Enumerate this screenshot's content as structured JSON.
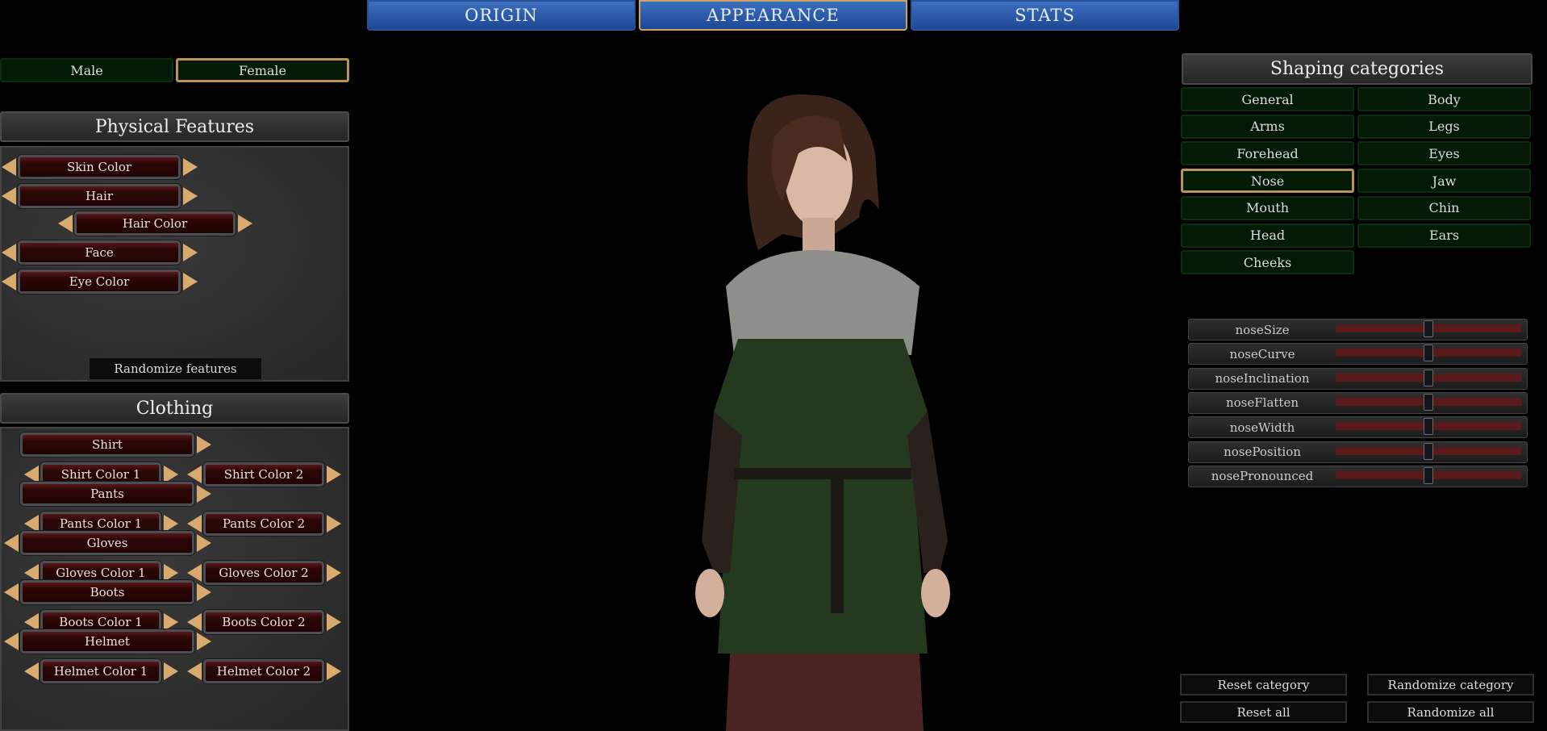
{
  "tabs": [
    {
      "label": "ORIGIN",
      "selected": false
    },
    {
      "label": "APPEARANCE",
      "selected": true
    },
    {
      "label": "STATS",
      "selected": false
    }
  ],
  "gender": {
    "options": [
      "Male",
      "Female"
    ],
    "selected": "Female"
  },
  "physical": {
    "title": "Physical Features",
    "items": [
      {
        "label": "Skin Color",
        "indent": false
      },
      {
        "label": "Hair",
        "indent": false
      },
      {
        "label": "Hair Color",
        "indent": true
      },
      {
        "label": "Face",
        "indent": false
      },
      {
        "label": "Eye Color",
        "indent": false
      }
    ],
    "randomize": "Randomize features"
  },
  "clothing": {
    "title": "Clothing",
    "groups": [
      {
        "label": "Shirt",
        "left_arrow": false,
        "colors": [
          "Shirt Color 1",
          "Shirt Color 2"
        ]
      },
      {
        "label": "Pants",
        "left_arrow": false,
        "colors": [
          "Pants Color 1",
          "Pants Color 2"
        ]
      },
      {
        "label": "Gloves",
        "left_arrow": true,
        "colors": [
          "Gloves Color 1",
          "Gloves Color 2"
        ]
      },
      {
        "label": "Boots",
        "left_arrow": true,
        "colors": [
          "Boots Color 1",
          "Boots Color 2"
        ]
      },
      {
        "label": "Helmet",
        "left_arrow": true,
        "colors": [
          "Helmet Color 1",
          "Helmet Color 2"
        ]
      }
    ]
  },
  "shaping": {
    "title": "Shaping categories",
    "categories": [
      "General",
      "Body",
      "Arms",
      "Legs",
      "Forehead",
      "Eyes",
      "Nose",
      "Jaw",
      "Mouth",
      "Chin",
      "Head",
      "Ears",
      "Cheeks"
    ],
    "selected": "Nose"
  },
  "sliders": [
    {
      "label": "noseSize",
      "value": 0.5
    },
    {
      "label": "noseCurve",
      "value": 0.5
    },
    {
      "label": "noseInclination",
      "value": 0.5
    },
    {
      "label": "noseFlatten",
      "value": 0.5
    },
    {
      "label": "noseWidth",
      "value": 0.5
    },
    {
      "label": "nosePosition",
      "value": 0.5
    },
    {
      "label": "nosePronounced",
      "value": 0.5
    }
  ],
  "actions": {
    "reset_category": "Reset category",
    "randomize_category": "Randomize category",
    "reset_all": "Reset all",
    "randomize_all": "Randomize all"
  },
  "colors": {
    "tab_blue": "#2a5aa8",
    "accent_gold": "#c9a265",
    "category_green": "#021a06",
    "button_red": "#2c0707",
    "slider_track": "#5a1a1a"
  }
}
